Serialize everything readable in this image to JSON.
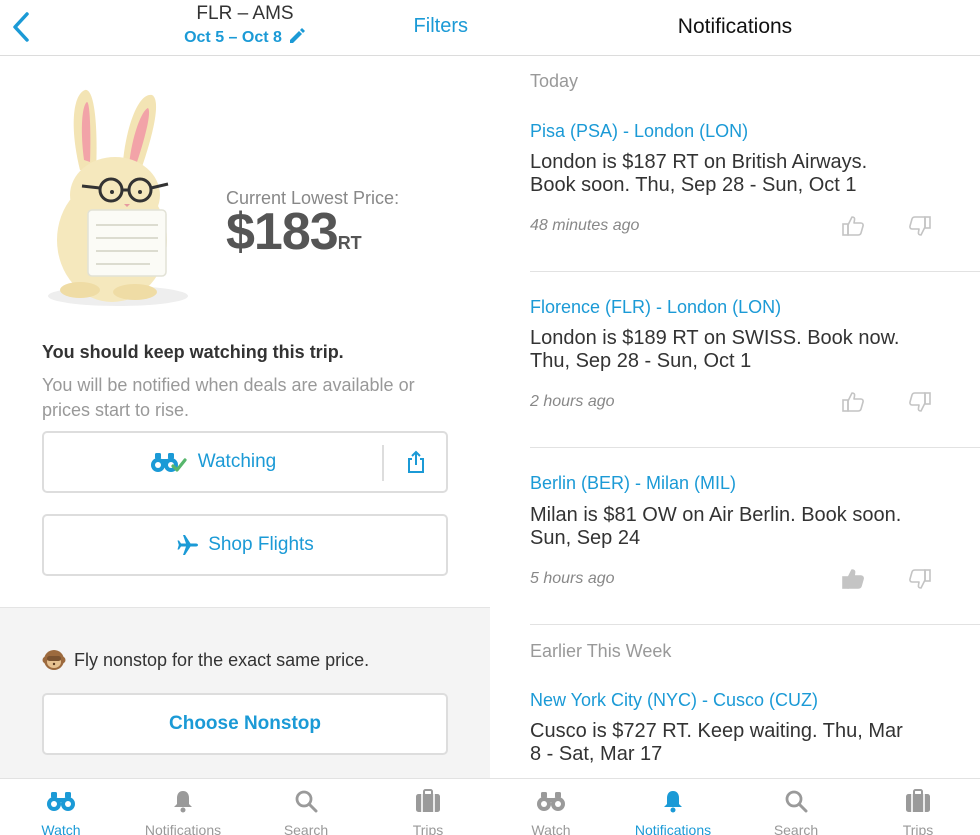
{
  "left": {
    "header": {
      "route": "FLR – AMS",
      "dates": "Oct 5 – Oct 8",
      "filters_label": "Filters"
    },
    "price": {
      "label": "Current Lowest Price:",
      "amount": "$183",
      "suffix": "RT"
    },
    "advice": {
      "title": "You should keep watching this trip.",
      "subtitle": "You will be notified when deals are available or prices start to rise."
    },
    "watch_button": {
      "label": "Watching"
    },
    "shop_button": {
      "label": "Shop Flights"
    },
    "nonstop": {
      "text": "Fly nonstop for the exact same price.",
      "button": "Choose Nonstop"
    },
    "tabs": [
      {
        "label": "Watch",
        "icon": "binoculars-icon",
        "active": true
      },
      {
        "label": "Notifications",
        "icon": "bell-icon",
        "active": false
      },
      {
        "label": "Search",
        "icon": "search-icon",
        "active": false
      },
      {
        "label": "Trips",
        "icon": "suitcase-icon",
        "active": false
      }
    ]
  },
  "right": {
    "header": {
      "title": "Notifications"
    },
    "sections": {
      "today": "Today",
      "earlier": "Earlier This Week"
    },
    "notifications": [
      {
        "route": "Pisa (PSA) - London (LON)",
        "line1": "London is $187 RT on British Airways.",
        "line2": "Book soon. Thu, Sep 28 - Sun, Oct 1",
        "time": "48 minutes ago",
        "liked": false
      },
      {
        "route": "Florence (FLR) - London (LON)",
        "line1": "London is $189 RT on SWISS. Book now.",
        "line2": "Thu, Sep 28 - Sun, Oct 1",
        "time": "2 hours ago",
        "liked": false
      },
      {
        "route": "Berlin (BER) - Milan (MIL)",
        "line1": "Milan is $81 OW on Air Berlin. Book soon.",
        "line2": "Sun, Sep 24",
        "time": "5 hours ago",
        "liked": true
      },
      {
        "route": "New York City (NYC) - Cusco (CUZ)",
        "line1": "Cusco is $727 RT. Keep waiting. Thu, Mar",
        "line2": "8 - Sat, Mar 17"
      }
    ],
    "tabs": [
      {
        "label": "Watch",
        "icon": "binoculars-icon",
        "active": false
      },
      {
        "label": "Notifications",
        "icon": "bell-icon",
        "active": true
      },
      {
        "label": "Search",
        "icon": "search-icon",
        "active": false
      },
      {
        "label": "Trips",
        "icon": "suitcase-icon",
        "active": false
      }
    ]
  },
  "colors": {
    "accent": "#1b9ad6",
    "muted": "#999999",
    "text": "#333333"
  }
}
